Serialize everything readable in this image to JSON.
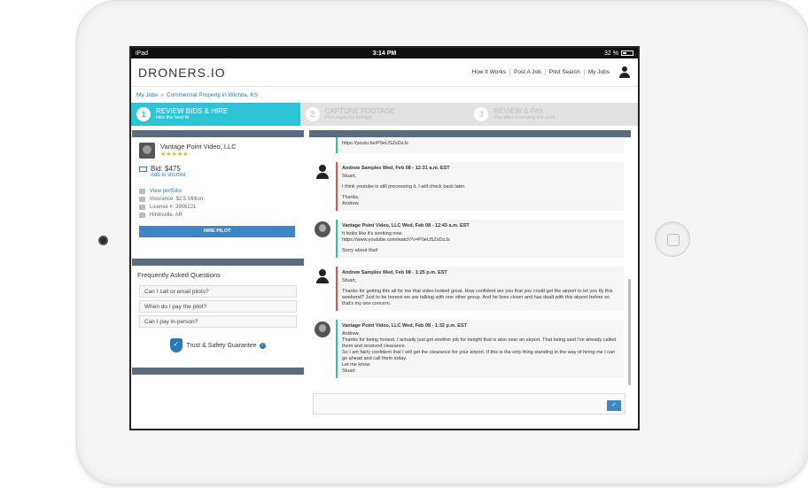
{
  "statusbar": {
    "device": "iPad",
    "time": "3:14 PM",
    "battery": "32 %"
  },
  "brand": {
    "logo": "DRONERS.IO"
  },
  "nav": {
    "links": [
      "How It Works",
      "Post A Job",
      "Pilot Search",
      "My Jobs"
    ]
  },
  "breadcrumb": {
    "root": "My Jobs",
    "separator": "»",
    "current": "Commercial Property in Wichita, KS"
  },
  "steps": [
    {
      "num": "1",
      "title": "REVIEW BIDS & HIRE",
      "subtitle": "Hire the best fit",
      "active": true
    },
    {
      "num": "2",
      "title": "CAPTURE FOOTAGE",
      "subtitle": "Pilot captures footage",
      "active": false
    },
    {
      "num": "3",
      "title": "REVIEW & PAY",
      "subtitle": "Pay after reviewing the work",
      "active": false
    }
  ],
  "pilot": {
    "name": "Vantage Point Video, LLC",
    "stars": "★★★★★",
    "bid": "Bid: $475",
    "shortlist": "Add to shortlist",
    "portfolio": "View portfolio",
    "insurance": "Insurance: $2.5 Million",
    "license": "License #: 3906221",
    "location": "Hindsville, AR",
    "hire_label": "HIRE PILOT"
  },
  "faq": {
    "title": "Frequently Asked Questions",
    "items": [
      "Can I call or email pilots?",
      "When do I pay the pilot?",
      "Can I pay in-person?"
    ]
  },
  "guarantee": {
    "label": "Trust & Safety Guarantee",
    "info": "i"
  },
  "messages": [
    {
      "type": "pilot",
      "head": "",
      "lines": [
        "https://youtu.be/P0eUSZsDzJs"
      ]
    },
    {
      "type": "user",
      "head": "Andrew Samples Wed, Feb 08 - 12:31 a.m. EST",
      "lines": [
        "Stuart,",
        "I think youtube is still processing it. I will check back later.",
        "Thanks,\nAndrew"
      ]
    },
    {
      "type": "pilot",
      "head": "Vantage Point Video, LLC Wed, Feb 08 - 12:43 a.m. EST",
      "lines": [
        "It looks like it's working now.\nhttps://www.youtube.com/watch?v=P0eUSZsDzJs",
        "Sorry about that!"
      ]
    },
    {
      "type": "user",
      "head": "Andrew Samples Wed, Feb 08 - 1:25 p.m. EST",
      "lines": [
        "Stuart,",
        "Thanks for getting this all for me that video looked great. How confident are you that you could get the airport to let you fly this weekend? Just to be honest we are talking with one other group. And he lives closer and has dealt with this airport before so that's my one concern."
      ]
    },
    {
      "type": "pilot",
      "head": "Vantage Point Video, LLC Wed, Feb 08 - 1:32 p.m. EST",
      "lines": [
        "Andrew,\nThanks for being honest. I actually just got another job for tonight that is also near an airport. That being said I've already called them and received clearance.\nSo I am fairly confident that I will get the clearance for your airport. If this is the only thing standing in the way of hiring me I can go ahead and call them today.\nLet me know.\nStuart"
      ]
    }
  ],
  "composer": {
    "send_icon": "✓"
  }
}
